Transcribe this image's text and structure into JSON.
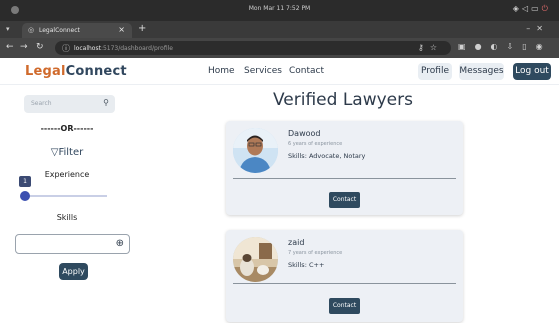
{
  "os": {
    "clock": "Mon Mar 11  7:52 PM",
    "tray_icons": [
      "network-icon",
      "volume-icon",
      "battery-icon",
      "power-icon"
    ]
  },
  "browser": {
    "tab_title": "LegalConnect",
    "new_tab": "+",
    "url_host": "localhost",
    "url_path": ":5173/dashboard/profile",
    "window_controls": [
      "minimize-icon",
      "close-icon"
    ]
  },
  "nav": {
    "brand_prefix": "Legal",
    "brand_suffix": "Connect",
    "links": [
      "Home",
      "Services",
      "Contact"
    ],
    "profile": "Profile",
    "messages": "Messages",
    "logout": "Log out"
  },
  "sidebar": {
    "search_placeholder": "Search",
    "or_text": "------OR------",
    "filter_label": "Filter",
    "experience_label": "Experience",
    "experience_value": "1",
    "experience_fraction": 0.02,
    "skills_label": "Skills",
    "skills_value": "",
    "apply_label": "Apply"
  },
  "main": {
    "heading": "Verified Lawyers",
    "lawyers": [
      {
        "name": "Dawood",
        "experience": "6 years of experience",
        "skills_label": "Skills:",
        "skills": "Advocate, Notary",
        "contact_label": "Contact"
      },
      {
        "name": "zaid",
        "experience": "7 years of experience",
        "skills_label": "Skills:",
        "skills": "C++",
        "contact_label": "Contact"
      }
    ]
  },
  "colors": {
    "brand_dark": "#31475e",
    "brand_accent": "#d06a2c",
    "button_dark": "#2f4a5f",
    "slider": "#3b4fb0",
    "card_bg": "#edf0f5"
  }
}
